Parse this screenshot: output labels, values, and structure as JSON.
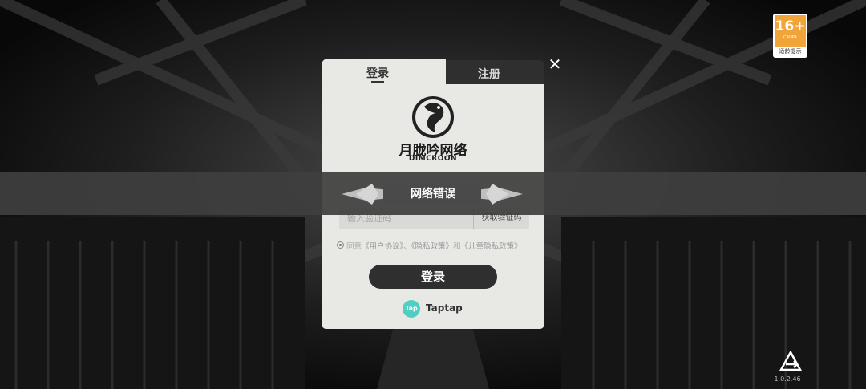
{
  "age_rating": {
    "number": "16+",
    "org": "CADPA",
    "label": "适龄提示"
  },
  "dialog": {
    "tab_login": "登录",
    "tab_register": "注册",
    "logo_name": "月胧吟网络",
    "logo_sub": "DIMCROON",
    "code_placeholder": "输入验证码",
    "get_code_label": "获取验证码",
    "agree_prefix": "同意",
    "user_agreement": "《用户协议》",
    "separator": "、",
    "privacy_policy": "《隐私政策》",
    "and": "和",
    "child_privacy_policy": "《儿童隐私政策》",
    "login_button": "登录",
    "taptap_icon_text": "Tap",
    "taptap_label": "Taptap"
  },
  "toast": {
    "message": "网络错误"
  },
  "version": "1.0.2.46",
  "icons": {
    "close": "close-icon",
    "exit": "exit-icon",
    "taptap": "taptap-icon",
    "logo": "dragon-emblem-icon"
  },
  "colors": {
    "panel": "#e8e8e5",
    "dark_button": "#2f2f2f",
    "age_badge": "#f0a43a",
    "taptap": "#4fcfc4"
  }
}
